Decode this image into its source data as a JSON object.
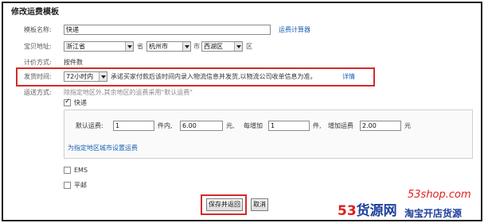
{
  "page": {
    "title": "修改运费模板"
  },
  "form": {
    "template_name_label": "模板名称:",
    "template_name_value": "快递",
    "calculator_link": "运费计算器",
    "location_label": "宝贝地址:",
    "province": "浙江省",
    "province_unit": "省",
    "city": "杭州市",
    "city_unit": "市",
    "district": "西湖区",
    "district_unit": "区",
    "pricing_label": "计价方式:",
    "pricing_value": "按件数",
    "ship_time_label": "发货时间:",
    "ship_time_value": "72小时内",
    "ship_time_note": "承诺买家付款后该时间内录入物流信息并发货,以物流公司收单信息为准。",
    "details_link": "详情",
    "shipping_method_label": "运送方式:",
    "shipping_method_note": "除指定地区外,其余地区的运费采用\"默认运费\""
  },
  "express": {
    "label": "快递",
    "checked": true,
    "default_fee_label": "默认运费:",
    "first_qty": "1",
    "first_qty_unit": "件内,",
    "first_fee": "6.00",
    "first_fee_unit": "元,",
    "extra_each_label": "每增加",
    "extra_qty": "1",
    "extra_qty_unit": "件,",
    "extra_fee_label": "增加运费",
    "extra_fee": "2.00",
    "extra_fee_unit": "元",
    "set_region_link": "为指定地区城市设置运费"
  },
  "other_methods": [
    {
      "label": "EMS",
      "checked": false
    },
    {
      "label": "平邮",
      "checked": false
    }
  ],
  "buttons": {
    "save_return": "保存并返回",
    "cancel": "取消"
  },
  "watermark": {
    "domain": "53shop.com",
    "brand_num": "53",
    "brand_text": "货源网",
    "slogan": "淘宝开店货源"
  },
  "colors": {
    "link": "#1a5fb4",
    "highlight": "#d52a2a",
    "watermark_red": "#e01e1e",
    "watermark_blue": "#1d3f9b"
  }
}
